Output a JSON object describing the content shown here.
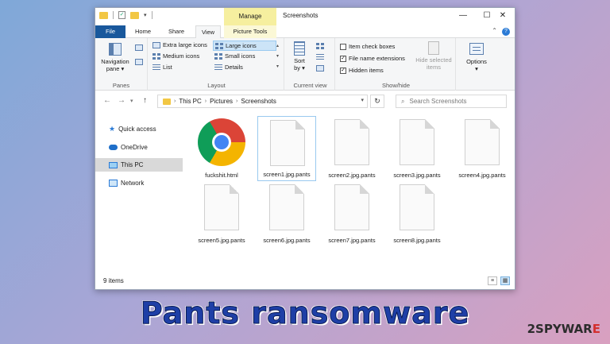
{
  "window": {
    "title": "Screenshots",
    "manage_tab": "Manage",
    "controls": {
      "minimize": "—",
      "maximize": "☐",
      "close": "✕"
    }
  },
  "ribbon_tabs": {
    "file": "File",
    "home": "Home",
    "share": "Share",
    "view": "View",
    "picture_tools": "Picture Tools"
  },
  "ribbon": {
    "panes": {
      "navigation_pane": "Navigation",
      "navigation_pane_line2": "pane ▾",
      "label": "Panes"
    },
    "layout": {
      "extra_large": "Extra large icons",
      "large": "Large icons",
      "medium": "Medium icons",
      "small": "Small icons",
      "list": "List",
      "details": "Details",
      "label": "Layout"
    },
    "current_view": {
      "sort_by": "Sort",
      "sort_by_line2": "by ▾",
      "label": "Current view"
    },
    "show_hide": {
      "item_check_boxes": "Item check boxes",
      "file_name_extensions": "File name extensions",
      "hidden_items": "Hidden items",
      "hide_selected": "Hide selected",
      "hide_selected_line2": "items",
      "label": "Show/hide"
    },
    "options": {
      "label": "Options",
      "line2": "▾"
    }
  },
  "address": {
    "crumbs": [
      "This PC",
      "Pictures",
      "Screenshots"
    ],
    "search_placeholder": "Search Screenshots"
  },
  "nav": {
    "items": [
      {
        "label": "Quick access",
        "icon": "star-icon"
      },
      {
        "label": "OneDrive",
        "icon": "cloud-icon"
      },
      {
        "label": "This PC",
        "icon": "computer-icon"
      },
      {
        "label": "Network",
        "icon": "network-icon"
      }
    ]
  },
  "files": [
    {
      "name": "fuckshit.html",
      "icon": "chrome-icon"
    },
    {
      "name": "screen1.jpg.pants",
      "icon": "blank-file-icon"
    },
    {
      "name": "screen2.jpg.pants",
      "icon": "blank-file-icon"
    },
    {
      "name": "screen3.jpg.pants",
      "icon": "blank-file-icon"
    },
    {
      "name": "screen4.jpg.pants",
      "icon": "blank-file-icon"
    },
    {
      "name": "screen5.jpg.pants",
      "icon": "blank-file-icon"
    },
    {
      "name": "screen6.jpg.pants",
      "icon": "blank-file-icon"
    },
    {
      "name": "screen7.jpg.pants",
      "icon": "blank-file-icon"
    },
    {
      "name": "screen8.jpg.pants",
      "icon": "blank-file-icon"
    }
  ],
  "status": {
    "item_count": "9 items"
  },
  "caption": "Pants ransomware",
  "watermark": {
    "prefix": "2",
    "brand": "SPYWAR",
    "suffix": "E"
  },
  "colors": {
    "file_tab": "#19589c",
    "manage_tab": "#f6ef9f",
    "caption": "#1e3fa6"
  }
}
